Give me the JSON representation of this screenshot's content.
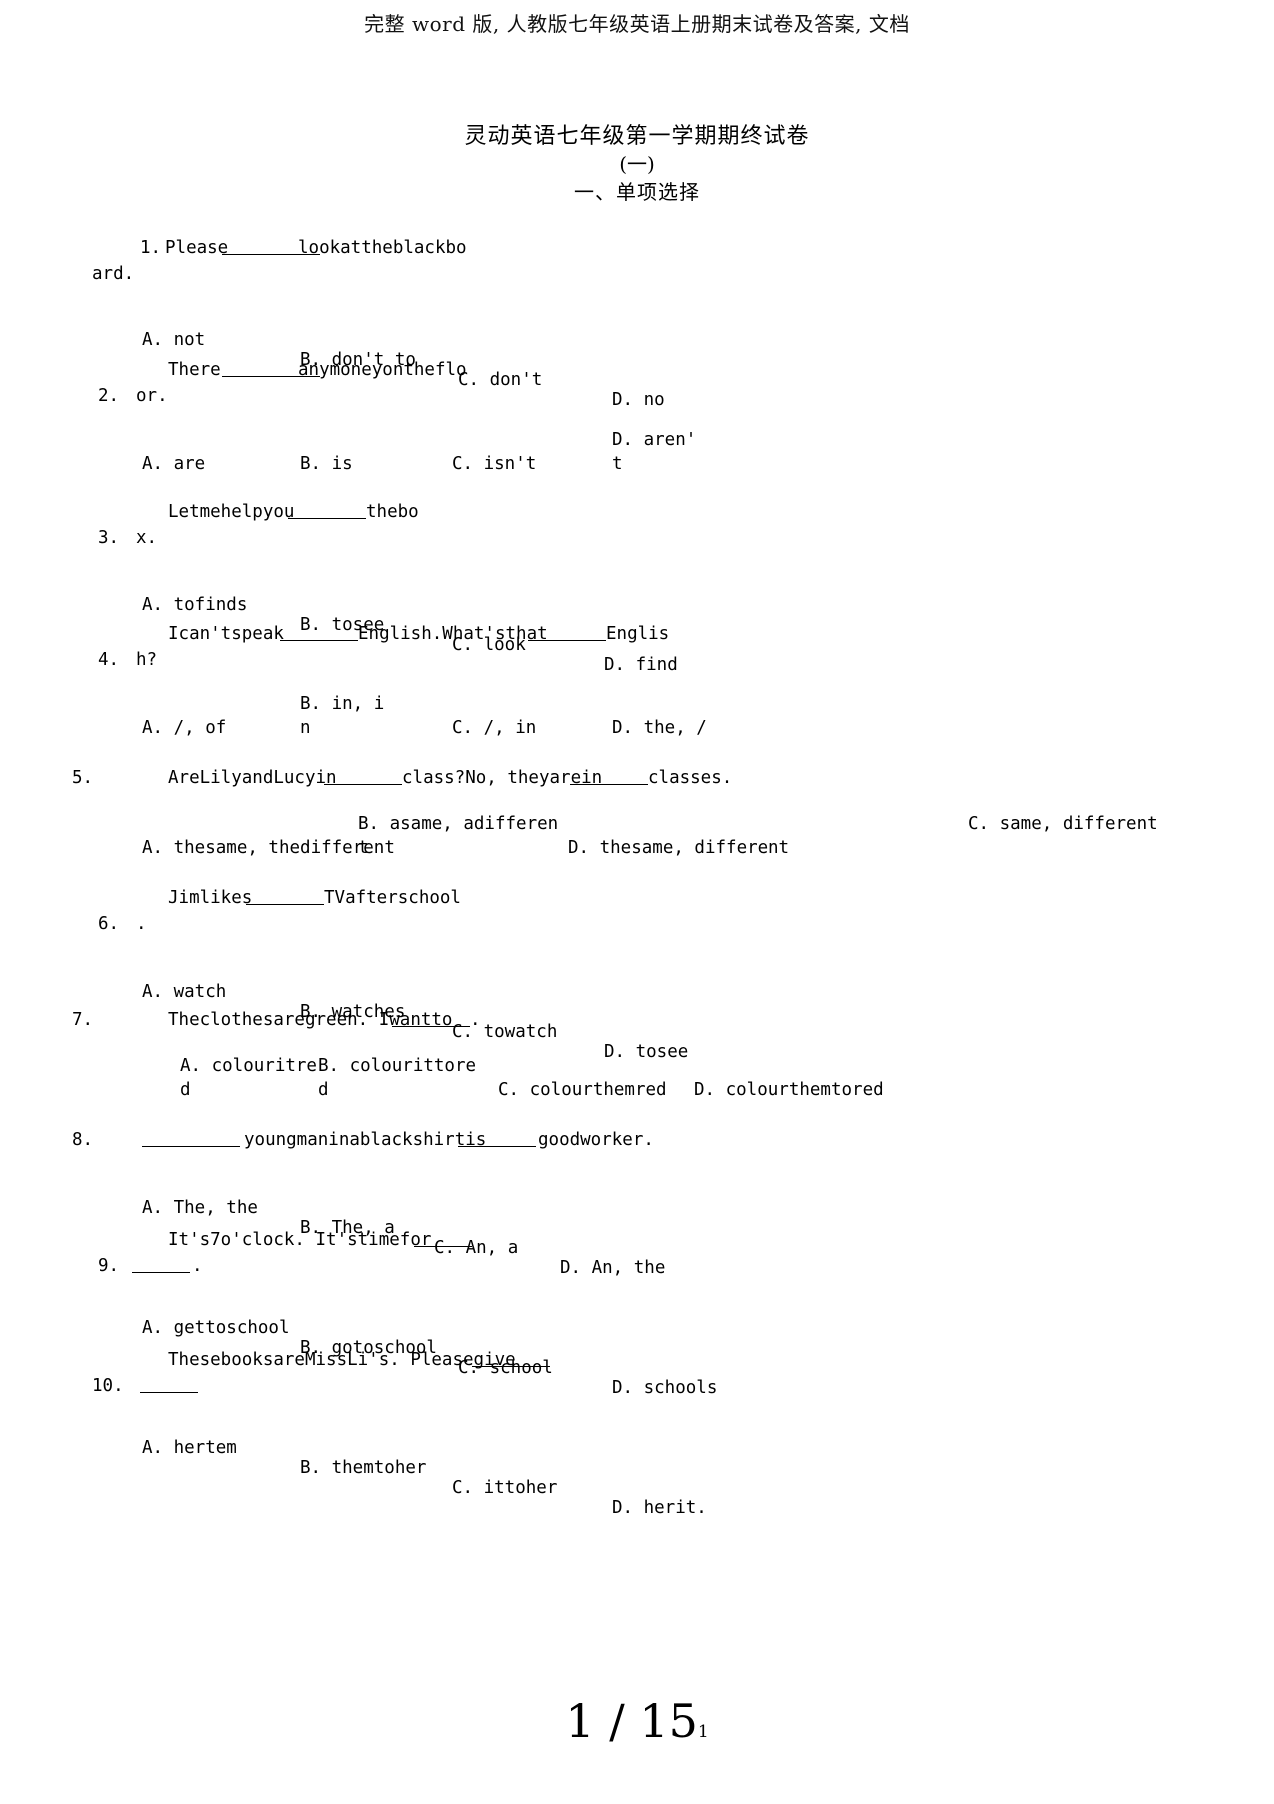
{
  "header": {
    "breadcrumb": "完整 word 版, 人教版七年级英语上册期末试卷及答案, 文档"
  },
  "title": {
    "main": "灵动英语七年级第一学期期终试卷",
    "sub": "(一)",
    "section": "一、单项选择"
  },
  "questions": [
    {
      "num": "1.",
      "stem_line1": "Please",
      "stem_line1_after": "lookattheblackbo",
      "stem_line2": "ard.",
      "options": [
        "A. not",
        "B. don't to",
        "C. don't",
        "D. no"
      ]
    },
    {
      "num": "2.",
      "stem_line1": "There",
      "stem_line1_after": "anymoneyontheflo",
      "stem_line2": "or.",
      "options": [
        "A. are",
        "B. is",
        "C. isn't",
        "D. aren'",
        "t"
      ]
    },
    {
      "num": "3.",
      "stem_line1": "Letmehelpyou",
      "stem_line1_after": "thebo",
      "stem_line2": "x.",
      "options": [
        "A. tofinds",
        "B. tosee",
        "C. look",
        "D. find"
      ]
    },
    {
      "num": "4.",
      "stem_line1": "Ican'tspeak",
      "stem_line1_mid": "English.What'sthat",
      "stem_line1_after": "Englis",
      "stem_line2": "h?",
      "options": [
        "A. /, of",
        "B. in, i",
        "n",
        "C. /, in",
        "D. the, /"
      ]
    },
    {
      "num": "5.",
      "stem_line1": "AreLilyandLucyin",
      "stem_line1_mid": "class?No, theyarein",
      "stem_line1_after": "classes.",
      "options": [
        "A. thesame, thedifferent",
        "B. asame, adifferen",
        "t",
        "C. same, different",
        "D. thesame, differe",
        "nt"
      ]
    },
    {
      "num": "6.",
      "stem_line1": "Jimlikes",
      "stem_line1_after": "TVafterschool",
      "stem_line2": ".",
      "options": [
        "A. watch",
        "B. watches",
        "C. towatch",
        "D. tosee"
      ]
    },
    {
      "num": "7.",
      "stem_line1": "Theclothesaregreen. Iwantto",
      "stem_line1_after": ".",
      "options": [
        "A. colouritre",
        "d",
        "B. colourittore",
        "d",
        "C. colourthemred",
        "D. colourthemtored"
      ]
    },
    {
      "num": "8.",
      "stem_line1": "",
      "stem_line1_after": "youngmaninablackshirtis",
      "stem_line1_after2": "goodworker.",
      "options": [
        "A. The, the",
        "B. The, a",
        "C. An, a",
        "D. An, the"
      ]
    },
    {
      "num": "9.",
      "stem_line1": "It's7o'clock. It'stimefor",
      "stem_line2": ".",
      "options": [
        "A. gettoschool",
        "B. gotoschool",
        "C. school",
        "D. schools"
      ]
    },
    {
      "num": "10.",
      "stem_line1": "ThesebooksareMissLi's. Pleasegive",
      "stem_line2": "",
      "options": [
        "A. hertem",
        "B. themtoher",
        "C. ittoher",
        "D. herit."
      ]
    }
  ],
  "footer": {
    "page_number": "1 / 15",
    "page_suffix": "1"
  }
}
